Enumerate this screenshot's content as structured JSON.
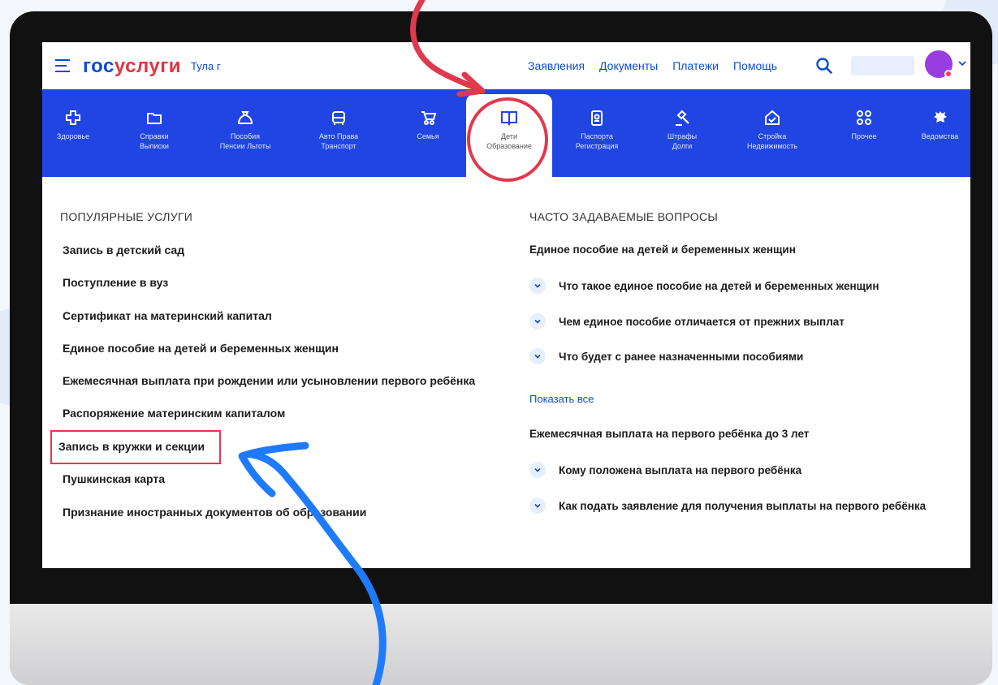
{
  "header": {
    "logo_part1": "гос",
    "logo_part2": "услуги",
    "city": "Тула г",
    "nav": [
      "Заявления",
      "Документы",
      "Платежи",
      "Помощь"
    ]
  },
  "categories": [
    {
      "label": "Здоровье",
      "icon": "health-icon"
    },
    {
      "label": "Справки\nВыписки",
      "icon": "folder-icon"
    },
    {
      "label": "Пособия\nПенсии Льготы",
      "icon": "bag-icon"
    },
    {
      "label": "Авто Права\nТранспорт",
      "icon": "car-icon"
    },
    {
      "label": "Семья",
      "icon": "stroller-icon"
    },
    {
      "label": "Дети\nОбразование",
      "icon": "book-icon",
      "active": true
    },
    {
      "label": "Паспорта\nРегистрация",
      "icon": "passport-icon"
    },
    {
      "label": "Штрафы\nДолги",
      "icon": "gavel-icon"
    },
    {
      "label": "Стройка\nНедвижимость",
      "icon": "house-icon"
    },
    {
      "label": "Прочее",
      "icon": "grid-icon"
    },
    {
      "label": "Ведомства",
      "icon": "emblem-icon"
    }
  ],
  "popular": {
    "title": "ПОПУЛЯРНЫЕ УСЛУГИ",
    "items": [
      "Запись в детский сад",
      "Поступление в вуз",
      "Сертификат на материнский капитал",
      "Единое пособие на детей и беременных женщин",
      "Ежемесячная выплата при рождении или усыновлении первого ребёнка",
      "Распоряжение материнским капиталом",
      "Запись в кружки и секции",
      "Пушкинская карта",
      "Признание иностранных документов об образовании"
    ]
  },
  "faq": {
    "title": "ЧАСТО ЗАДАВАЕМЫЕ ВОПРОСЫ",
    "group1_title": "Единое пособие на детей и беременных женщин",
    "group1_questions": [
      "Что такое единое пособие на детей и беременных женщин",
      "Чем единое пособие отличается от прежних выплат",
      "Что будет с ранее назначенными пособиями"
    ],
    "show_all": "Показать все",
    "group2_title": "Ежемесячная выплата на первого ребёнка до 3 лет",
    "group2_questions": [
      "Кому положена выплата на первого ребёнка",
      "Как подать заявление для получения выплаты на первого ребёнка"
    ]
  },
  "colors": {
    "brand_blue": "#0d4cd3",
    "category_bar": "#2145e3",
    "brand_red": "#e3343f",
    "annotation_red": "#e0394d",
    "annotation_blue": "#1e7bff"
  }
}
